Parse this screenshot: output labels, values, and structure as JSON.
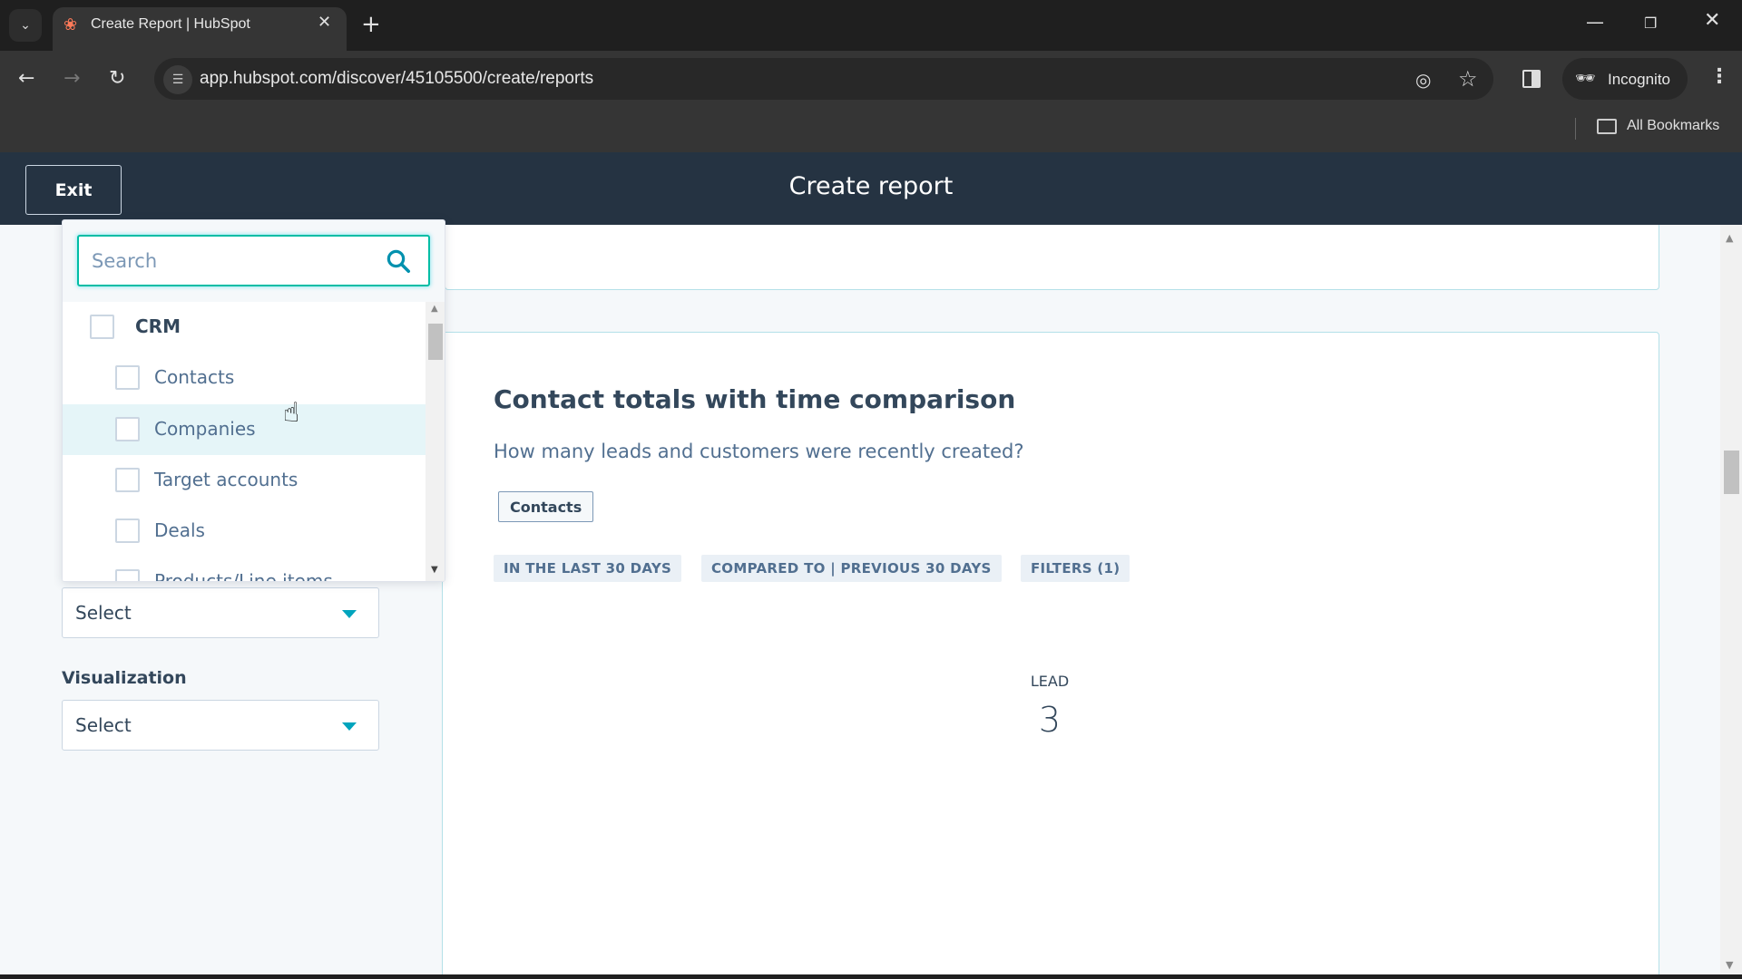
{
  "browser": {
    "tab_title": "Create Report | HubSpot",
    "url": "app.hubspot.com/discover/45105500/create/reports",
    "incognito_label": "Incognito",
    "bookmarks_label": "All Bookmarks",
    "icons": {
      "tab_list": "chevron-down-icon",
      "favicon": "hubspot-sprocket-icon",
      "tab_close": "close-icon",
      "new_tab": "plus-icon",
      "back": "arrow-left-icon",
      "forward": "arrow-right-icon",
      "reload": "reload-icon",
      "site_info": "tune-icon",
      "eye_off": "eye-off-icon",
      "bookmark": "star-icon",
      "side_panel": "side-panel-icon",
      "incognito": "incognito-icon",
      "menu": "more-vertical-icon",
      "folder": "folder-icon"
    }
  },
  "header": {
    "exit_label": "Exit",
    "title": "Create report"
  },
  "data_source_dropdown": {
    "search_placeholder": "Search",
    "search_value": "",
    "items": [
      {
        "label": "CRM",
        "type": "group",
        "checked": false
      },
      {
        "label": "Contacts",
        "type": "item",
        "checked": false
      },
      {
        "label": "Companies",
        "type": "item",
        "checked": false,
        "hovered": true
      },
      {
        "label": "Target accounts",
        "type": "item",
        "checked": false
      },
      {
        "label": "Deals",
        "type": "item",
        "checked": false
      },
      {
        "label": "Products/Line items",
        "type": "item",
        "checked": false
      }
    ]
  },
  "form": {
    "select_1_value": "Select",
    "visualization_label": "Visualization",
    "visualization_value": "Select"
  },
  "report_card": {
    "title": "Contact totals with time comparison",
    "subtitle": "How many leads and customers were recently created?",
    "object_tag": "Contacts",
    "chips": [
      "IN THE LAST 30 DAYS",
      "COMPARED TO | PREVIOUS 30 DAYS",
      "FILTERS (1)"
    ],
    "metric_label": "LEAD",
    "metric_value": "3"
  },
  "colors": {
    "header_bg": "#253342",
    "accent_teal": "#00a4bd",
    "focus_border": "#00bda5",
    "text_primary": "#33475b",
    "chip_bg": "#eaf0f6",
    "hover_row": "#e5f5f8"
  }
}
